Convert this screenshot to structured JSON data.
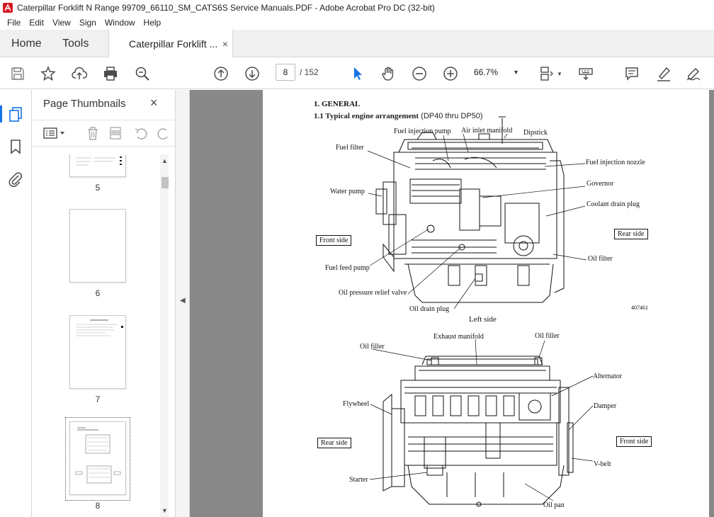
{
  "window": {
    "title": "Caterpillar Forklift N Range 99709_66110_SM_CATS6S Service Manuals.PDF - Adobe Acrobat Pro DC (32-bit)"
  },
  "menu": [
    "File",
    "Edit",
    "View",
    "Sign",
    "Window",
    "Help"
  ],
  "tabs": {
    "home": "Home",
    "tools": "Tools",
    "document": "Caterpillar Forklift ...",
    "close": "×"
  },
  "toolbar": {
    "page_current": "8",
    "page_total": "/ 152",
    "zoom": "66.7%",
    "zoom_caret": "▼"
  },
  "panel": {
    "title": "Page Thumbnails",
    "close": "×",
    "thumbnails": [
      {
        "number": "5"
      },
      {
        "number": "6"
      },
      {
        "number": "7"
      },
      {
        "number": "8"
      }
    ],
    "selected_page": "8"
  },
  "document": {
    "heading1": "1.  GENERAL",
    "heading2_bold": "1.1  Typical engine arrangement",
    "heading2_normal": "(DP40 thru DP50)",
    "figure1": {
      "labels": {
        "fuel_injection_pump": "Fuel injection pump",
        "air_inlet_manifold": "Air inlet manifold",
        "dipstick": "Dipstick",
        "fuel_filter": "Fuel filter",
        "fuel_injection_nozzle": "Fuel injection nozzle",
        "water_pump": "Water pump",
        "governor": "Governor",
        "coolant_drain_plug": "Coolant drain plug",
        "rear_side": "Rear side",
        "front_side": "Front side",
        "oil_filter": "Oil filter",
        "fuel_feed_pump": "Fuel feed pump",
        "oil_pressure_relief_valve": "Oil pressure relief valve",
        "oil_drain_plug": "Oil drain plug",
        "figure_number": "407461",
        "caption": "Left side"
      }
    },
    "figure2": {
      "labels": {
        "exhaust_manifold": "Exhaust manifold",
        "oil_filler_left": "Oil filler",
        "oil_filler_right": "Oil filler",
        "alternator": "Alternator",
        "flywheel": "Flywheel",
        "damper": "Damper",
        "rear_side": "Rear side",
        "front_side": "Front side",
        "v_belt": "V-belt",
        "starter": "Starter",
        "oil_pan": "Oil pan"
      }
    }
  },
  "colors": {
    "accent": "#1473e6",
    "icon": "#4b4b4b",
    "doc_background": "#888888",
    "acrobat_red": "#d71921"
  }
}
